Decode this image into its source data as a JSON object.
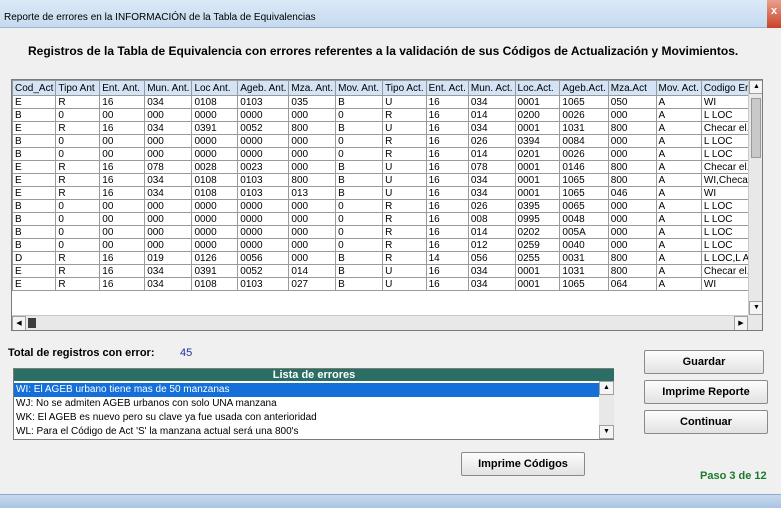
{
  "window": {
    "title": "Reporte de errores en la INFORMACIÓN de la Tabla de Equivalencias",
    "close_glyph": "x"
  },
  "heading": "Registros de la Tabla de Equivalencia con errores referentes a la validación de sus Códigos de Actualización y Movimientos.",
  "grid": {
    "columns": [
      "Cod_Act",
      "Tipo Ant",
      "Ent. Ant.",
      "Mun. Ant.",
      "Loc Ant.",
      "Ageb. Ant.",
      "Mza. Ant.",
      "Mov. Ant.",
      "Tipo Act.",
      "Ent. Act.",
      "Mun. Act.",
      "Loc.Act.",
      "Ageb.Act.",
      "Mza.Act",
      "Mov. Act.",
      "Codigo Err"
    ],
    "rows": [
      [
        "E",
        "R",
        "16",
        "034",
        "0108",
        "0103",
        "035",
        "B",
        "U",
        "16",
        "034",
        "0001",
        "1065",
        "050",
        "A",
        "WI"
      ],
      [
        "B",
        "0",
        "00",
        "000",
        "0000",
        "0000",
        "000",
        "0",
        "R",
        "16",
        "014",
        "0200",
        "0026",
        "000",
        "A",
        "L LOC"
      ],
      [
        "E",
        "R",
        "16",
        "034",
        "0391",
        "0052",
        "800",
        "B",
        "U",
        "16",
        "034",
        "0001",
        "1031",
        "800",
        "A",
        "Checar el..."
      ],
      [
        "B",
        "0",
        "00",
        "000",
        "0000",
        "0000",
        "000",
        "0",
        "R",
        "16",
        "026",
        "0394",
        "0084",
        "000",
        "A",
        "L LOC"
      ],
      [
        "B",
        "0",
        "00",
        "000",
        "0000",
        "0000",
        "000",
        "0",
        "R",
        "16",
        "014",
        "0201",
        "0026",
        "000",
        "A",
        "L LOC"
      ],
      [
        "E",
        "R",
        "16",
        "078",
        "0028",
        "0023",
        "000",
        "B",
        "U",
        "16",
        "078",
        "0001",
        "0146",
        "800",
        "A",
        "Checar el..."
      ],
      [
        "E",
        "R",
        "16",
        "034",
        "0108",
        "0103",
        "800",
        "B",
        "U",
        "16",
        "034",
        "0001",
        "1065",
        "800",
        "A",
        "WI,Checar..."
      ],
      [
        "E",
        "R",
        "16",
        "034",
        "0108",
        "0103",
        "013",
        "B",
        "U",
        "16",
        "034",
        "0001",
        "1065",
        "046",
        "A",
        "WI"
      ],
      [
        "B",
        "0",
        "00",
        "000",
        "0000",
        "0000",
        "000",
        "0",
        "R",
        "16",
        "026",
        "0395",
        "0065",
        "000",
        "A",
        "L LOC"
      ],
      [
        "B",
        "0",
        "00",
        "000",
        "0000",
        "0000",
        "000",
        "0",
        "R",
        "16",
        "008",
        "0995",
        "0048",
        "000",
        "A",
        "L LOC"
      ],
      [
        "B",
        "0",
        "00",
        "000",
        "0000",
        "0000",
        "000",
        "0",
        "R",
        "16",
        "014",
        "0202",
        "005A",
        "000",
        "A",
        "L LOC"
      ],
      [
        "B",
        "0",
        "00",
        "000",
        "0000",
        "0000",
        "000",
        "0",
        "R",
        "16",
        "012",
        "0259",
        "0040",
        "000",
        "A",
        "L LOC"
      ],
      [
        "D",
        "R",
        "16",
        "019",
        "0126",
        "0056",
        "000",
        "B",
        "R",
        "14",
        "056",
        "0255",
        "0031",
        "800",
        "A",
        "L LOC,L A..."
      ],
      [
        "E",
        "R",
        "16",
        "034",
        "0391",
        "0052",
        "014",
        "B",
        "U",
        "16",
        "034",
        "0001",
        "1031",
        "800",
        "A",
        "Checar el..."
      ],
      [
        "E",
        "R",
        "16",
        "034",
        "0108",
        "0103",
        "027",
        "B",
        "U",
        "16",
        "034",
        "0001",
        "1065",
        "064",
        "A",
        "WI"
      ]
    ]
  },
  "total": {
    "label": "Total de registros con error:",
    "value": "45"
  },
  "error_list": {
    "header": "Lista de errores",
    "items": [
      "WI: El  AGEB urbano tiene mas de 50 manzanas",
      "WJ: No se admiten AGEB urbanos con solo UNA manzana",
      "WK: El AGEB es nuevo pero su clave ya fue usada con anterioridad",
      "WL: Para el Código de Act 'S' la manzana actual será  una 800's"
    ],
    "selected_index": 0
  },
  "buttons": {
    "guardar": "Guardar",
    "imprime_reporte": "Imprime Reporte",
    "continuar": "Continuar",
    "imprime_codigos": "Imprime Códigos"
  },
  "step": "Paso 3 de 12"
}
